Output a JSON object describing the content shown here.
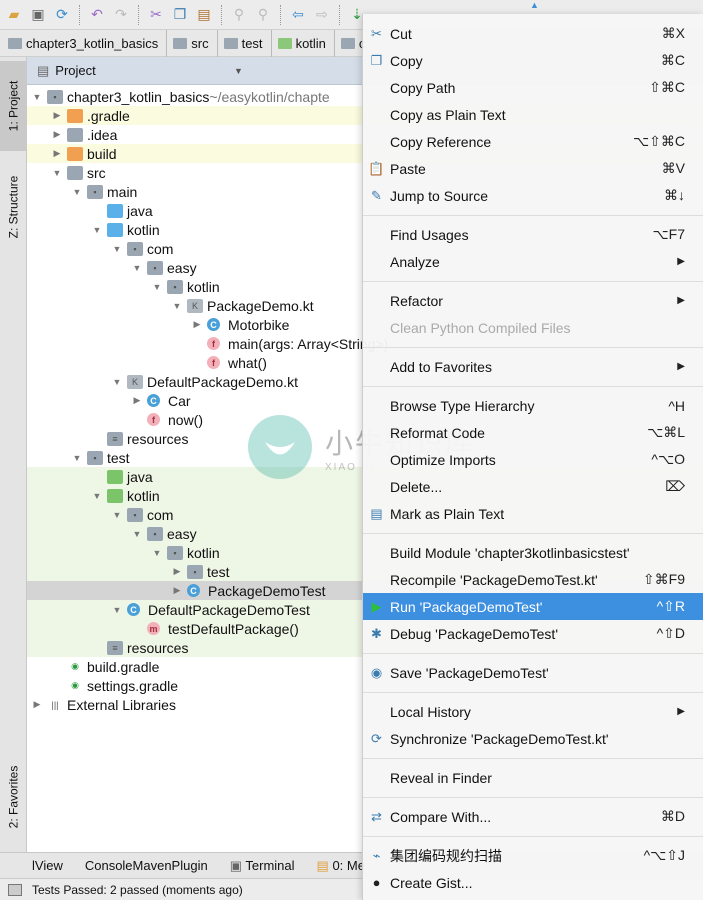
{
  "toolbar": {
    "icons": [
      "open-icon",
      "save-icon",
      "sync-icon",
      "undo-icon",
      "redo-icon",
      "cut-icon",
      "copy-icon",
      "paste-icon",
      "find-icon",
      "replace-icon",
      "back-icon",
      "forward-icon",
      "make-icon"
    ]
  },
  "breadcrumb": [
    "chapter3_kotlin_basics",
    "src",
    "test",
    "kotlin",
    "c"
  ],
  "left_tabs": {
    "project": "1: Project",
    "structure": "Z: Structure",
    "favorites": "2: Favorites"
  },
  "panel": {
    "title": "Project"
  },
  "tree": [
    {
      "label": "chapter3_kotlin_basics",
      "suffix": " ~/easykotlin/chapte",
      "level": 0,
      "arrow": "open",
      "icon": "module",
      "bg": ""
    },
    {
      "label": ".gradle",
      "level": 1,
      "arrow": "closed",
      "icon": "folder-orange",
      "bg": "y"
    },
    {
      "label": ".idea",
      "level": 1,
      "arrow": "closed",
      "icon": "folder",
      "bg": ""
    },
    {
      "label": "build",
      "level": 1,
      "arrow": "closed",
      "icon": "folder-orange",
      "bg": "y"
    },
    {
      "label": "src",
      "level": 1,
      "arrow": "open",
      "icon": "folder",
      "bg": ""
    },
    {
      "label": "main",
      "level": 2,
      "arrow": "open",
      "icon": "module",
      "bg": ""
    },
    {
      "label": "java",
      "level": 3,
      "arrow": "",
      "icon": "folder-blue",
      "bg": ""
    },
    {
      "label": "kotlin",
      "level": 3,
      "arrow": "open",
      "icon": "folder-blue",
      "bg": ""
    },
    {
      "label": "com",
      "level": 4,
      "arrow": "open",
      "icon": "package",
      "bg": ""
    },
    {
      "label": "easy",
      "level": 5,
      "arrow": "open",
      "icon": "package",
      "bg": ""
    },
    {
      "label": "kotlin",
      "level": 6,
      "arrow": "open",
      "icon": "package",
      "bg": ""
    },
    {
      "label": "PackageDemo.kt",
      "level": 7,
      "arrow": "open",
      "icon": "kotlin-file",
      "bg": ""
    },
    {
      "label": "Motorbike",
      "level": 8,
      "arrow": "closed",
      "icon": "class",
      "bg": ""
    },
    {
      "label": "main(args: Array<String>)",
      "level": 8,
      "arrow": "",
      "icon": "function",
      "bg": ""
    },
    {
      "label": "what()",
      "level": 8,
      "arrow": "",
      "icon": "function",
      "bg": ""
    },
    {
      "label": "DefaultPackageDemo.kt",
      "level": 4,
      "arrow": "open",
      "icon": "kotlin-file",
      "bg": ""
    },
    {
      "label": "Car",
      "level": 5,
      "arrow": "closed",
      "icon": "class",
      "bg": ""
    },
    {
      "label": "now()",
      "level": 5,
      "arrow": "",
      "icon": "function",
      "bg": ""
    },
    {
      "label": "resources",
      "level": 3,
      "arrow": "",
      "icon": "resources",
      "bg": ""
    },
    {
      "label": "test",
      "level": 2,
      "arrow": "open",
      "icon": "module",
      "bg": ""
    },
    {
      "label": "java",
      "level": 3,
      "arrow": "",
      "icon": "folder-green",
      "bg": "g"
    },
    {
      "label": "kotlin",
      "level": 3,
      "arrow": "open",
      "icon": "folder-green",
      "bg": "g"
    },
    {
      "label": "com",
      "level": 4,
      "arrow": "open",
      "icon": "package",
      "bg": "g"
    },
    {
      "label": "easy",
      "level": 5,
      "arrow": "open",
      "icon": "package",
      "bg": "g"
    },
    {
      "label": "kotlin",
      "level": 6,
      "arrow": "open",
      "icon": "package",
      "bg": "g"
    },
    {
      "label": "test",
      "level": 7,
      "arrow": "closed",
      "icon": "package",
      "bg": "g"
    },
    {
      "label": "PackageDemoTest",
      "level": 7,
      "arrow": "closed",
      "icon": "class",
      "bg": "sel"
    },
    {
      "label": "DefaultPackageDemoTest",
      "level": 4,
      "arrow": "open",
      "icon": "class",
      "bg": "g"
    },
    {
      "label": "testDefaultPackage()",
      "level": 5,
      "arrow": "",
      "icon": "method",
      "bg": "g"
    },
    {
      "label": "resources",
      "level": 3,
      "arrow": "",
      "icon": "resources",
      "bg": "g"
    },
    {
      "label": "build.gradle",
      "level": 1,
      "arrow": "",
      "icon": "gradle",
      "bg": ""
    },
    {
      "label": "settings.gradle",
      "level": 1,
      "arrow": "",
      "icon": "gradle",
      "bg": ""
    },
    {
      "label": "External Libraries",
      "level": 0,
      "arrow": "closed",
      "icon": "library",
      "bg": ""
    }
  ],
  "bottom_tabs": [
    "lView",
    "ConsoleMavenPlugin",
    "Terminal",
    "0: Me"
  ],
  "status": {
    "text": "Tests Passed: 2 passed (moments ago)"
  },
  "watermark": {
    "cn": "小牛知识库",
    "en": "XIAO NIU ZHI SHI KU"
  },
  "menu": [
    {
      "label": "Cut",
      "shortcut": "⌘X",
      "icon": "✂"
    },
    {
      "label": "Copy",
      "shortcut": "⌘C",
      "icon": "❐"
    },
    {
      "label": "Copy Path",
      "shortcut": "⇧⌘C"
    },
    {
      "label": "Copy as Plain Text",
      "shortcut": ""
    },
    {
      "label": "Copy Reference",
      "shortcut": "⌥⇧⌘C"
    },
    {
      "label": "Paste",
      "shortcut": "⌘V",
      "icon": "📋"
    },
    {
      "label": "Jump to Source",
      "shortcut": "⌘↓",
      "icon": "✎"
    },
    {
      "sep": true
    },
    {
      "label": "Find Usages",
      "shortcut": "⌥F7"
    },
    {
      "label": "Analyze",
      "shortcut": "▶"
    },
    {
      "sep": true
    },
    {
      "label": "Refactor",
      "shortcut": "▶"
    },
    {
      "label": "Clean Python Compiled Files",
      "shortcut": "",
      "disabled": true
    },
    {
      "sep": true
    },
    {
      "label": "Add to Favorites",
      "shortcut": "▶"
    },
    {
      "sep": true
    },
    {
      "label": "Browse Type Hierarchy",
      "shortcut": "^H"
    },
    {
      "label": "Reformat Code",
      "shortcut": "⌥⌘L"
    },
    {
      "label": "Optimize Imports",
      "shortcut": "^⌥O"
    },
    {
      "label": "Delete...",
      "shortcut": "⌦"
    },
    {
      "label": "Mark as Plain Text",
      "shortcut": "",
      "icon": "▤"
    },
    {
      "sep": true
    },
    {
      "label": "Build Module 'chapter3kotlinbasicstest'",
      "shortcut": ""
    },
    {
      "label": "Recompile 'PackageDemoTest.kt'",
      "shortcut": "⇧⌘F9"
    },
    {
      "label": "Run 'PackageDemoTest'",
      "shortcut": "^⇧R",
      "icon": "▶",
      "highlight": true
    },
    {
      "label": "Debug 'PackageDemoTest'",
      "shortcut": "^⇧D",
      "icon": "✱"
    },
    {
      "sep": true
    },
    {
      "label": "Save 'PackageDemoTest'",
      "shortcut": "",
      "icon": "◉"
    },
    {
      "sep": true
    },
    {
      "label": "Local History",
      "shortcut": "▶"
    },
    {
      "label": "Synchronize 'PackageDemoTest.kt'",
      "shortcut": "",
      "icon": "⟳"
    },
    {
      "sep": true
    },
    {
      "label": "Reveal in Finder",
      "shortcut": ""
    },
    {
      "sep": true
    },
    {
      "label": "Compare With...",
      "shortcut": "⌘D",
      "icon": "⇄"
    },
    {
      "sep": true
    },
    {
      "label": "集团编码规约扫描",
      "shortcut": "^⌥⇧J",
      "icon": "⌁"
    },
    {
      "label": "Create Gist...",
      "shortcut": "",
      "icon": "●"
    }
  ],
  "colors": {
    "highlight": "#3d8fe0",
    "selected_row": "#d4d4d4",
    "test_bg": "#eef6e6",
    "excluded_bg": "#fbfbe0"
  }
}
